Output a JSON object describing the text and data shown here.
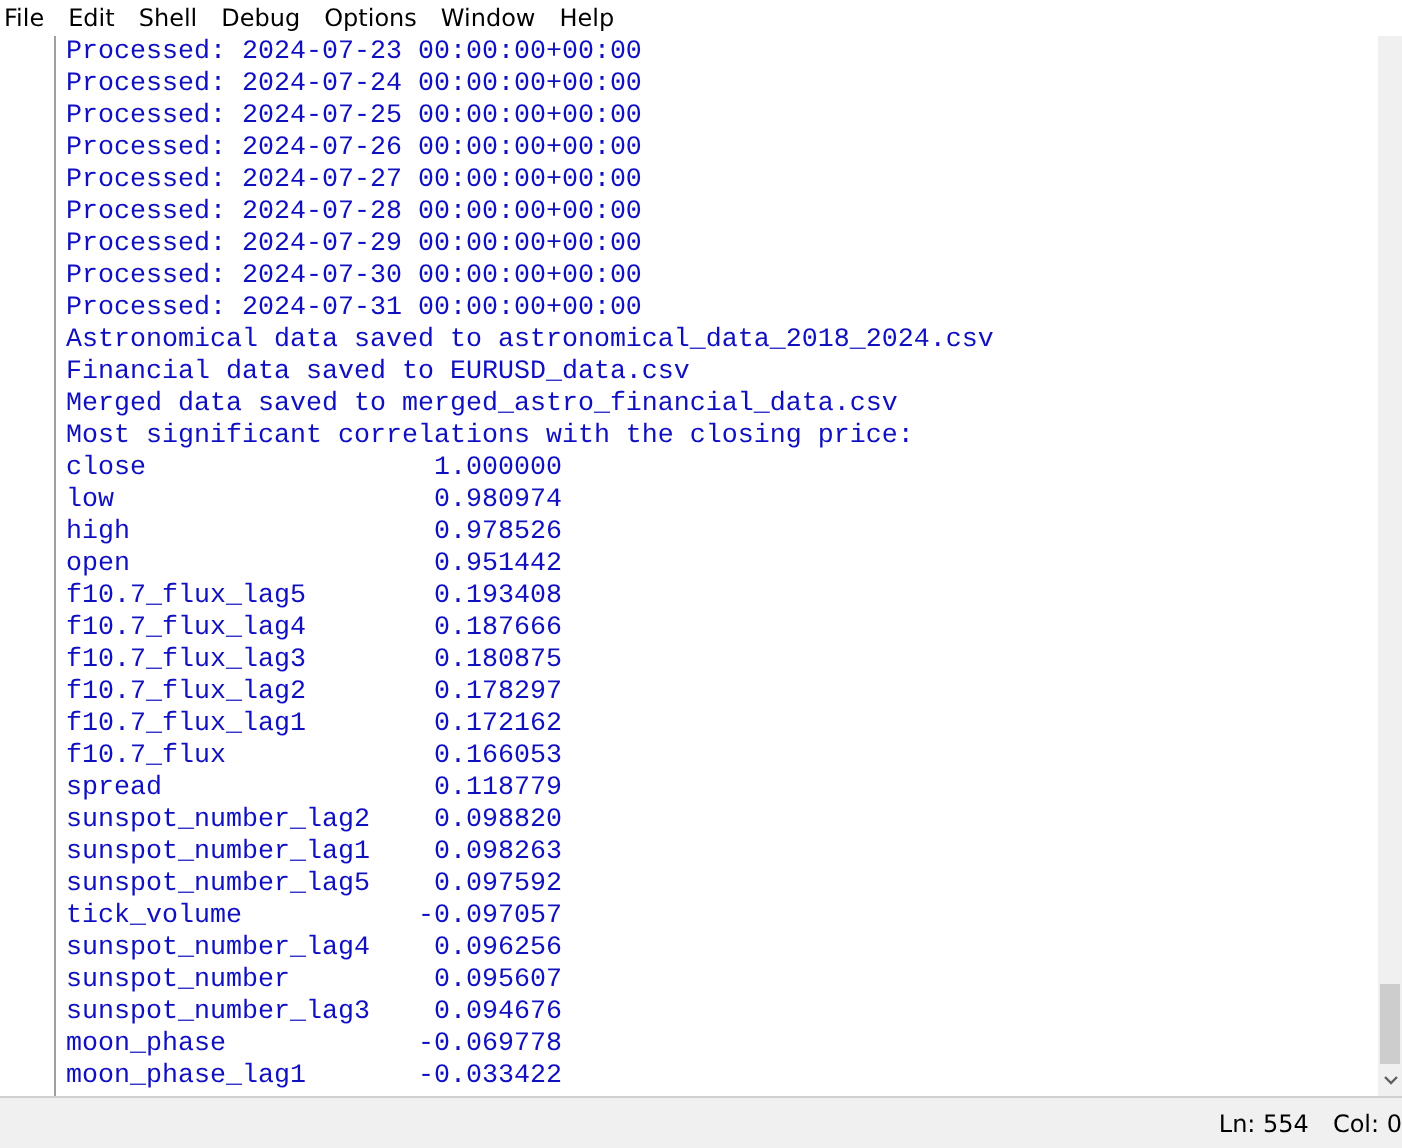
{
  "menu": [
    "File",
    "Edit",
    "Shell",
    "Debug",
    "Options",
    "Window",
    "Help"
  ],
  "output_lines": [
    "Processed: 2024-07-23 00:00:00+00:00",
    "Processed: 2024-07-24 00:00:00+00:00",
    "Processed: 2024-07-25 00:00:00+00:00",
    "Processed: 2024-07-26 00:00:00+00:00",
    "Processed: 2024-07-27 00:00:00+00:00",
    "Processed: 2024-07-28 00:00:00+00:00",
    "Processed: 2024-07-29 00:00:00+00:00",
    "Processed: 2024-07-30 00:00:00+00:00",
    "Processed: 2024-07-31 00:00:00+00:00",
    "Astronomical data saved to astronomical_data_2018_2024.csv",
    "Financial data saved to EURUSD_data.csv",
    "Merged data saved to merged_astro_financial_data.csv",
    "Most significant correlations with the closing price:",
    "close                  1.000000",
    "low                    0.980974",
    "high                   0.978526",
    "open                   0.951442",
    "f10.7_flux_lag5        0.193408",
    "f10.7_flux_lag4        0.187666",
    "f10.7_flux_lag3        0.180875",
    "f10.7_flux_lag2        0.178297",
    "f10.7_flux_lag1        0.172162",
    "f10.7_flux             0.166053",
    "spread                 0.118779",
    "sunspot_number_lag2    0.098820",
    "sunspot_number_lag1    0.098263",
    "sunspot_number_lag5    0.097592",
    "tick_volume           -0.097057",
    "sunspot_number_lag4    0.096256",
    "sunspot_number         0.095607",
    "sunspot_number_lag3    0.094676",
    "moon_phase            -0.069778",
    "moon_phase_lag1       -0.033422"
  ],
  "status_bar": {
    "line": "Ln: 554",
    "column": "Col: 0"
  }
}
